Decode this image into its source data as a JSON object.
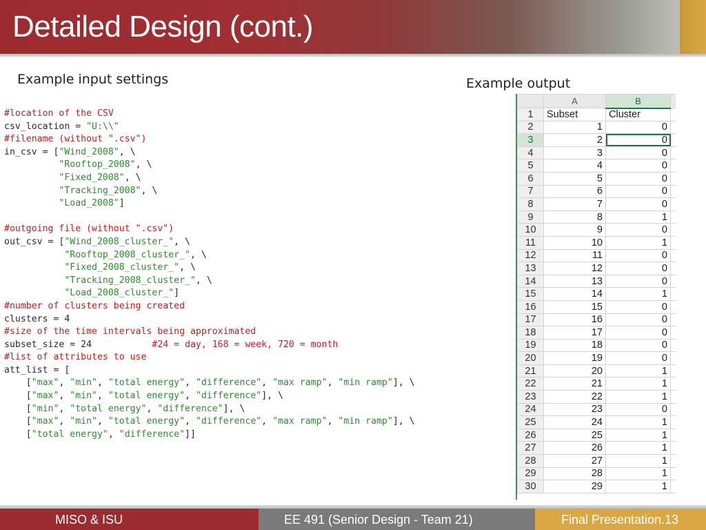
{
  "slide": {
    "title": "Detailed Design (cont.)",
    "left_label": "Example input settings",
    "right_label": "Example output"
  },
  "code_lines": [
    [
      {
        "t": "#location of the CSV",
        "c": "cm"
      }
    ],
    [
      {
        "t": "csv_location = ",
        "c": "plain"
      },
      {
        "t": "\"U:\\\\\"",
        "c": "st"
      }
    ],
    [
      {
        "t": "#filename (without \".csv\")",
        "c": "cm"
      }
    ],
    [
      {
        "t": "in_csv = [",
        "c": "plain"
      },
      {
        "t": "\"Wind_2008\"",
        "c": "st"
      },
      {
        "t": ", \\",
        "c": "plain"
      }
    ],
    [
      {
        "t": "          ",
        "c": "plain"
      },
      {
        "t": "\"Rooftop_2008\"",
        "c": "st"
      },
      {
        "t": ", \\",
        "c": "plain"
      }
    ],
    [
      {
        "t": "          ",
        "c": "plain"
      },
      {
        "t": "\"Fixed_2008\"",
        "c": "st"
      },
      {
        "t": ", \\",
        "c": "plain"
      }
    ],
    [
      {
        "t": "          ",
        "c": "plain"
      },
      {
        "t": "\"Tracking_2008\"",
        "c": "st"
      },
      {
        "t": ", \\",
        "c": "plain"
      }
    ],
    [
      {
        "t": "          ",
        "c": "plain"
      },
      {
        "t": "\"Load_2008\"",
        "c": "st"
      },
      {
        "t": "]",
        "c": "plain"
      }
    ],
    [
      {
        "t": "",
        "c": "plain"
      }
    ],
    [
      {
        "t": "#outgoing file (without \".csv\")",
        "c": "cm"
      }
    ],
    [
      {
        "t": "out_csv = [",
        "c": "plain"
      },
      {
        "t": "\"Wind_2008_cluster_\"",
        "c": "st"
      },
      {
        "t": ", \\",
        "c": "plain"
      }
    ],
    [
      {
        "t": "           ",
        "c": "plain"
      },
      {
        "t": "\"Rooftop_2008_cluster_\"",
        "c": "st"
      },
      {
        "t": ", \\",
        "c": "plain"
      }
    ],
    [
      {
        "t": "           ",
        "c": "plain"
      },
      {
        "t": "\"Fixed_2008_cluster_\"",
        "c": "st"
      },
      {
        "t": ", \\",
        "c": "plain"
      }
    ],
    [
      {
        "t": "           ",
        "c": "plain"
      },
      {
        "t": "\"Tracking_2008_cluster_\"",
        "c": "st"
      },
      {
        "t": ", \\",
        "c": "plain"
      }
    ],
    [
      {
        "t": "           ",
        "c": "plain"
      },
      {
        "t": "\"Load_2008_cluster_\"",
        "c": "st"
      },
      {
        "t": "]",
        "c": "plain"
      }
    ],
    [
      {
        "t": "#number of clusters being created",
        "c": "cm"
      }
    ],
    [
      {
        "t": "clusters = 4",
        "c": "plain"
      }
    ],
    [
      {
        "t": "#size of the time intervals being approximated",
        "c": "cm"
      }
    ],
    [
      {
        "t": "subset_size = 24           ",
        "c": "plain"
      },
      {
        "t": "#24 = day, 168 = week, 720 = month",
        "c": "cm"
      }
    ],
    [
      {
        "t": "#list of attributes to use",
        "c": "cm"
      }
    ],
    [
      {
        "t": "att_list = [",
        "c": "plain"
      }
    ],
    [
      {
        "t": "    [",
        "c": "plain"
      },
      {
        "t": "\"max\"",
        "c": "st"
      },
      {
        "t": ", ",
        "c": "plain"
      },
      {
        "t": "\"min\"",
        "c": "st"
      },
      {
        "t": ", ",
        "c": "plain"
      },
      {
        "t": "\"total energy\"",
        "c": "st"
      },
      {
        "t": ", ",
        "c": "plain"
      },
      {
        "t": "\"difference\"",
        "c": "st"
      },
      {
        "t": ", ",
        "c": "plain"
      },
      {
        "t": "\"max ramp\"",
        "c": "st"
      },
      {
        "t": ", ",
        "c": "plain"
      },
      {
        "t": "\"min ramp\"",
        "c": "st"
      },
      {
        "t": "], \\",
        "c": "plain"
      }
    ],
    [
      {
        "t": "    [",
        "c": "plain"
      },
      {
        "t": "\"max\"",
        "c": "st"
      },
      {
        "t": ", ",
        "c": "plain"
      },
      {
        "t": "\"min\"",
        "c": "st"
      },
      {
        "t": ", ",
        "c": "plain"
      },
      {
        "t": "\"total energy\"",
        "c": "st"
      },
      {
        "t": ", ",
        "c": "plain"
      },
      {
        "t": "\"difference\"",
        "c": "st"
      },
      {
        "t": "], \\",
        "c": "plain"
      }
    ],
    [
      {
        "t": "    [",
        "c": "plain"
      },
      {
        "t": "\"min\"",
        "c": "st"
      },
      {
        "t": ", ",
        "c": "plain"
      },
      {
        "t": "\"total energy\"",
        "c": "st"
      },
      {
        "t": ", ",
        "c": "plain"
      },
      {
        "t": "\"difference\"",
        "c": "st"
      },
      {
        "t": "], \\",
        "c": "plain"
      }
    ],
    [
      {
        "t": "    [",
        "c": "plain"
      },
      {
        "t": "\"max\"",
        "c": "st"
      },
      {
        "t": ", ",
        "c": "plain"
      },
      {
        "t": "\"min\"",
        "c": "st"
      },
      {
        "t": ", ",
        "c": "plain"
      },
      {
        "t": "\"total energy\"",
        "c": "st"
      },
      {
        "t": ", ",
        "c": "plain"
      },
      {
        "t": "\"difference\"",
        "c": "st"
      },
      {
        "t": ", ",
        "c": "plain"
      },
      {
        "t": "\"max ramp\"",
        "c": "st"
      },
      {
        "t": ", ",
        "c": "plain"
      },
      {
        "t": "\"min ramp\"",
        "c": "st"
      },
      {
        "t": "], \\",
        "c": "plain"
      }
    ],
    [
      {
        "t": "    [",
        "c": "plain"
      },
      {
        "t": "\"total energy\"",
        "c": "st"
      },
      {
        "t": ", ",
        "c": "plain"
      },
      {
        "t": "\"difference\"",
        "c": "st"
      },
      {
        "t": "]]",
        "c": "plain"
      }
    ]
  ],
  "spreadsheet": {
    "columns": [
      "A",
      "B"
    ],
    "header_row": [
      "Subset",
      "Cluster"
    ],
    "rows": [
      [
        1,
        0
      ],
      [
        2,
        0
      ],
      [
        3,
        0
      ],
      [
        4,
        0
      ],
      [
        5,
        0
      ],
      [
        6,
        0
      ],
      [
        7,
        0
      ],
      [
        8,
        1
      ],
      [
        9,
        0
      ],
      [
        10,
        1
      ],
      [
        11,
        0
      ],
      [
        12,
        0
      ],
      [
        13,
        0
      ],
      [
        14,
        1
      ],
      [
        15,
        0
      ],
      [
        16,
        0
      ],
      [
        17,
        0
      ],
      [
        18,
        0
      ],
      [
        19,
        0
      ],
      [
        20,
        1
      ],
      [
        21,
        1
      ],
      [
        22,
        1
      ],
      [
        23,
        0
      ],
      [
        24,
        1
      ],
      [
        25,
        1
      ],
      [
        26,
        1
      ],
      [
        27,
        1
      ],
      [
        28,
        1
      ],
      [
        29,
        1
      ]
    ],
    "selected_row_number": 3
  },
  "footer": {
    "left": "MISO & ISU",
    "center": "EE 491 (Senior Design - Team 21)",
    "right": "Final Presentation.13"
  },
  "colors": {
    "brand_red": "#9c2b30",
    "brand_gold": "#d9a744",
    "footer_gray": "#7a7a7a",
    "excel_green": "#217346"
  }
}
